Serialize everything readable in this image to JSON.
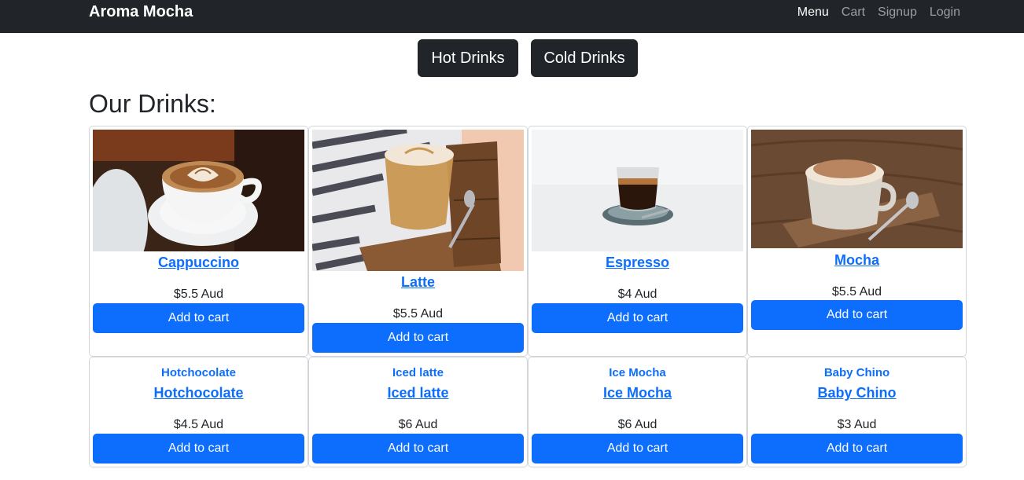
{
  "nav": {
    "brand": "Aroma Mocha",
    "links": [
      "Menu",
      "Cart",
      "Signup",
      "Login"
    ]
  },
  "filters": {
    "hot": "Hot Drinks",
    "cold": "Cold Drinks"
  },
  "heading": "Our Drinks:",
  "add_label": "Add to cart",
  "colors": {
    "navbar": "#212529",
    "primary": "#0d6efd"
  },
  "products": [
    {
      "name": "Cappuccino",
      "price": "$5.5 Aud",
      "image": "cappuccino-photo"
    },
    {
      "name": "Latte",
      "price": "$5.5 Aud",
      "image": "latte-photo"
    },
    {
      "name": "Espresso",
      "price": "$4 Aud",
      "image": "espresso-photo"
    },
    {
      "name": "Mocha",
      "price": "$5.5 Aud",
      "image": "mocha-photo"
    },
    {
      "name": "Hotchocolate",
      "alt": "Hotchocolate",
      "price": "$4.5 Aud"
    },
    {
      "name": "Iced latte",
      "alt": "Iced latte",
      "price": "$6 Aud"
    },
    {
      "name": "Ice Mocha",
      "alt": "Ice Mocha",
      "price": "$6 Aud"
    },
    {
      "name": "Baby Chino",
      "alt": "Baby Chino",
      "price": "$3 Aud"
    }
  ]
}
